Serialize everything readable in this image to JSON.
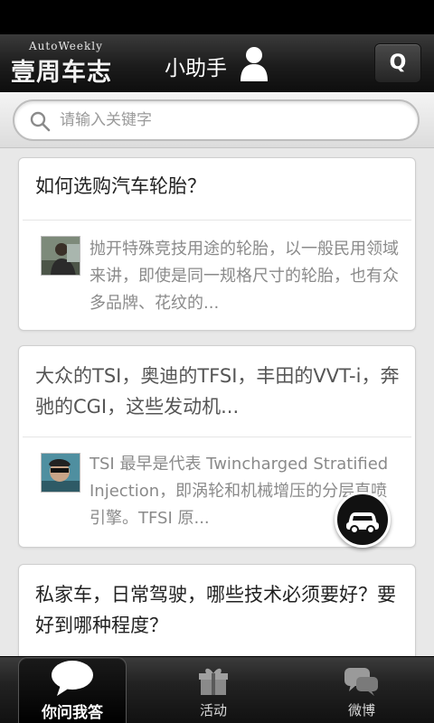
{
  "header": {
    "logo_small": "AutoWeekly",
    "logo_main": "壹周车志",
    "title": "小助手",
    "search_button_label": "Q"
  },
  "search": {
    "placeholder": "请输入关键字"
  },
  "feed": {
    "items": [
      {
        "question": "如何选购汽车轮胎？",
        "answer": "抛开特殊竞技用途的轮胎，以一般民用领域来讲，即使是同一规格尺寸的轮胎，也有众多品牌、花纹的..."
      },
      {
        "question": "大众的TSI，奥迪的TFSI，丰田的VVT-i，奔驰的CGI，这些发动机...",
        "answer": "TSI 最早是代表 Twincharged Stratified Injection，即涡轮和机械增压的分层直喷引擎。TFSI 原..."
      },
      {
        "question": "私家车，日常驾驶，哪些技术必须要好？要好到哪种程度？"
      }
    ]
  },
  "tabs": [
    {
      "label": "你问我答",
      "icon": "chat-bubble-icon",
      "active": true
    },
    {
      "label": "活动",
      "icon": "gift-icon",
      "active": false
    },
    {
      "label": "微博",
      "icon": "weibo-icon",
      "active": false
    }
  ],
  "colors": {
    "header_bg": "#1c1c1c",
    "page_bg": "#e8e8e8",
    "card_bg": "#ffffff",
    "answer_text": "#8a8a8a"
  }
}
